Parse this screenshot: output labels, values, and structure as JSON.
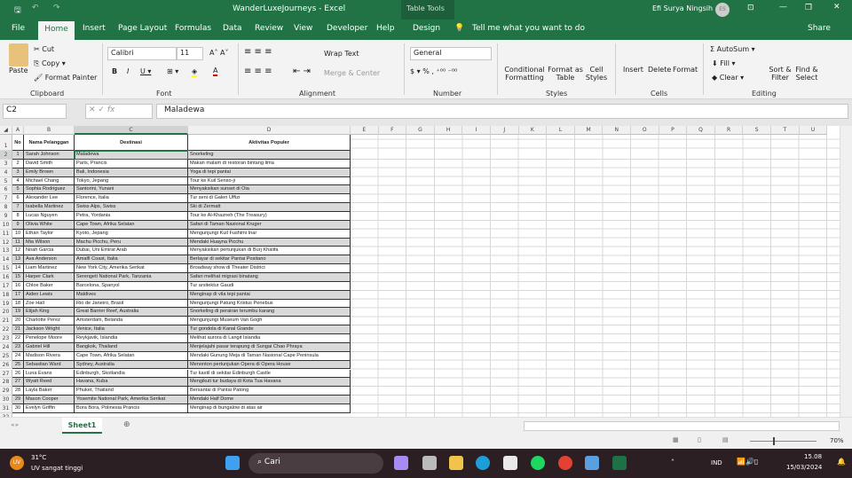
{
  "title": {
    "doc": "WanderLuxeJourneys  -  Excel",
    "table_tools": "Table Tools",
    "user": "Efi Surya Ningsih",
    "initials": "ES"
  },
  "tabs": [
    "File",
    "Home",
    "Insert",
    "Page Layout",
    "Formulas",
    "Data",
    "Review",
    "View",
    "Developer",
    "Help",
    "Design"
  ],
  "tell_me": "Tell me what you want to do",
  "share": "Share",
  "ribbon": {
    "paste": "Paste",
    "cut": "Cut",
    "copy": "Copy",
    "format_painter": "Format Painter",
    "font": "Calibri",
    "size": "11",
    "wrap": "Wrap Text",
    "merge": "Merge & Center",
    "number_format": "General",
    "cond": "Conditional Formatting",
    "fmt_table": "Format as Table",
    "cell_styles": "Cell Styles",
    "insert": "Insert",
    "delete": "Delete",
    "format": "Format",
    "autosum": "AutoSum",
    "fill": "Fill",
    "clear": "Clear",
    "sort": "Sort & Filter",
    "find": "Find & Select",
    "groups": [
      "Clipboard",
      "Font",
      "Alignment",
      "Number",
      "Styles",
      "Cells",
      "Editing"
    ]
  },
  "formula_bar": {
    "name_box": "C2",
    "value": "Maladewa"
  },
  "columns": [
    "A",
    "B",
    "C",
    "D",
    "E",
    "F",
    "G",
    "H",
    "I",
    "J",
    "K",
    "L",
    "M",
    "N",
    "O",
    "P",
    "Q",
    "R",
    "S",
    "T",
    "U"
  ],
  "table": {
    "headers": [
      "No",
      "Nama Pelanggan",
      "Destinasi",
      "Aktivitas Populer"
    ],
    "rows": [
      [
        "1",
        "Sarah Johnson",
        "Maladewa",
        "Snorkeling"
      ],
      [
        "2",
        "David Smith",
        "Paris, Prancis",
        "Makan malam di restoran bintang lima"
      ],
      [
        "3",
        "Emily Brown",
        "Bali, Indonesia",
        "Yoga di tepi pantai"
      ],
      [
        "4",
        "Michael Chang",
        "Tokyo, Jepang",
        "Tour ke Kuil Senso-ji"
      ],
      [
        "5",
        "Sophia Rodriguez",
        "Santorini, Yunani",
        "Menyaksikan sunset di Oia"
      ],
      [
        "6",
        "Alexander Lee",
        "Florence, Italia",
        "Tur seni di Galeri Uffizi"
      ],
      [
        "7",
        "Isabella Martinez",
        "Swiss Alps, Swiss",
        "Ski di Zermatt"
      ],
      [
        "8",
        "Lucas Nguyen",
        "Petra, Yordania",
        "Tour ke Al-Khazneh (The Treasury)"
      ],
      [
        "9",
        "Olivia White",
        "Cape Town, Afrika Selatan",
        "Safari di Taman Nasional Kruger"
      ],
      [
        "10",
        "Ethan Taylor",
        "Kyoto, Jepang",
        "Mengunjungi Kuil Fushimi Inar"
      ],
      [
        "11",
        "Mia Wilson",
        "Machu Picchu, Peru",
        "Mendaki Huayna Picchu"
      ],
      [
        "12",
        "Noah Garcia",
        "Dubai, Uni Emirat Arab",
        "Menyaksikan pertunjukan di Burj Khalifa"
      ],
      [
        "13",
        "Ava Anderson",
        "Amalfi Coast, Italia",
        "Berlayar di sekitar Pantai Positano"
      ],
      [
        "14",
        "Liam Martinez",
        "New York City, Amerika Serikat",
        "Broadway show di Theater District"
      ],
      [
        "15",
        "Harper Clark",
        "Serengeti National Park, Tanzania",
        "Safari melihat migrasi binatang"
      ],
      [
        "16",
        "Chloe Baker",
        "Barcelona, Spanyol",
        "Tur arsitektur Gaudi"
      ],
      [
        "17",
        "Aiden Lewis",
        "Maldives",
        "Menginap di vila tepi pantai"
      ],
      [
        "18",
        "Zoe Hall",
        "Rio de Janeiro, Brasil",
        "Mengunjungi Patung Kristus Penebus"
      ],
      [
        "19",
        "Elijah King",
        "Great Barrier Reef, Australia",
        "Snorkeling di perairan terumbu karang"
      ],
      [
        "20",
        "Charlotte Perez",
        "Amsterdam, Belanda",
        "Mengunjungi Museum Van Gogh"
      ],
      [
        "21",
        "Jackson Wright",
        "Venice, Italia",
        "Tur gondola di Kanal Grande"
      ],
      [
        "22",
        "Penelope Moore",
        "Reykjavik, Islandia",
        "Melihat aurora di Langit Islandia"
      ],
      [
        "23",
        "Gabriel Hill",
        "Bangkok, Thailand",
        "Menjelajahi pasar terapung di Sungai Chao Phraya"
      ],
      [
        "24",
        "Madison Rivera",
        "Cape Town, Afrika Selatan",
        "Mendaki Gunung Meja di Taman Nasional Cape Peninsula"
      ],
      [
        "25",
        "Sebastian Ward",
        "Sydney, Australia",
        "Menonton pertunjukan Opera di Opera House"
      ],
      [
        "26",
        "Luna Evans",
        "Edinburgh, Skotlandia",
        "Tur kastil di sekitar Edinburgh Castle"
      ],
      [
        "27",
        "Wyatt Reed",
        "Havana, Kuba",
        "Mengikuti tur budaya di Kota Tua Havana"
      ],
      [
        "28",
        "Layla Baker",
        "Phuket, Thailand",
        "Bersantai di Pantai Patong"
      ],
      [
        "29",
        "Mason Cooper",
        "Yosemite National Park, Amerika Serikat",
        "Mendaki Half Dome"
      ],
      [
        "30",
        "Evelyn Griffin",
        "Bora Bora, Polinesia Prancis",
        "Menginap di bungalow di atas air"
      ]
    ]
  },
  "sheet_tab": "Sheet1",
  "zoom": "70%",
  "taskbar": {
    "temp": "31°C",
    "weather": "UV sangat tinggi",
    "weather_badge": "UV",
    "search": "Cari",
    "lang": "IND",
    "time": "15.08",
    "date": "15/03/2024"
  },
  "colors": {
    "excel_green": "#217346",
    "band": "#d9d9d9"
  }
}
